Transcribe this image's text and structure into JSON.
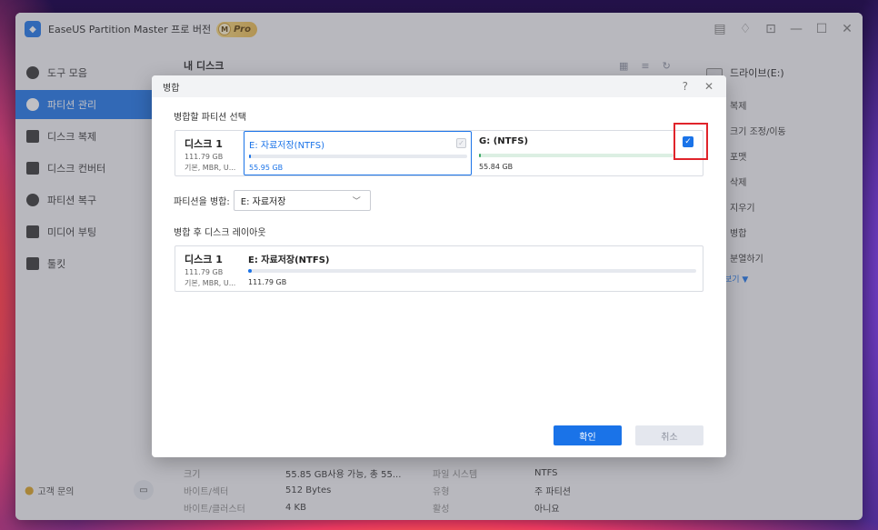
{
  "app": {
    "title": "EaseUS Partition Master 프로 버전",
    "badge": "Pro",
    "badge_letter": "M"
  },
  "sidebar": {
    "items": [
      {
        "label": "도구 모음",
        "icon": "compass-icon"
      },
      {
        "label": "파티션 관리",
        "icon": "pie-chart-icon",
        "active": true
      },
      {
        "label": "디스크 복제",
        "icon": "disk-clone-icon"
      },
      {
        "label": "디스크 컨버터",
        "icon": "disk-converter-icon"
      },
      {
        "label": "파티션 복구",
        "icon": "partition-recovery-icon"
      },
      {
        "label": "미디어 부팅",
        "icon": "media-boot-icon"
      },
      {
        "label": "툴킷",
        "icon": "toolkit-icon"
      }
    ],
    "support_label": "고객 문의"
  },
  "main": {
    "header": "내 디스크"
  },
  "right_panel": {
    "title": "드라이브(E:)",
    "ops": [
      "복제",
      "크기 조정/이동",
      "포맷",
      "삭제",
      "지우기",
      "병합",
      "분열하기"
    ],
    "more": "보기 ▼"
  },
  "properties": [
    {
      "k1": "크기",
      "v1": "55.85 GB사용 가능, 총 55...",
      "k2": "파일 시스템",
      "v2": "NTFS"
    },
    {
      "k1": "바이트/섹터",
      "v1": "512 Bytes",
      "k2": "유형",
      "v2": "주 파티션"
    },
    {
      "k1": "바이트/클러스터",
      "v1": "4 KB",
      "k2": "활성",
      "v2": "아니요"
    }
  ],
  "dialog": {
    "title": "병합",
    "select_label": "병합할 파티션 선택",
    "disk": {
      "name": "디스크 1",
      "size": "111.79 GB",
      "type": "기본, MBR, U..."
    },
    "partitions": [
      {
        "name": "E: 자료저장(NTFS)",
        "size": "55.95 GB",
        "selected": true,
        "used_fraction": 0.005,
        "color": "#1a73e8"
      },
      {
        "name": "G: (NTFS)",
        "size": "55.84 GB",
        "selected": false,
        "checked": true,
        "used_fraction": 0.005,
        "color": "#3aa765"
      }
    ],
    "merge_to_label": "파티션을 병합:",
    "merge_to_value": "E: 자료저장",
    "layout_label": "병합 후 디스크 레이아웃",
    "result": {
      "name": "E: 자료저장(NTFS)",
      "size": "111.79 GB",
      "used_fraction": 0.003
    },
    "ok_label": "확인",
    "cancel_label": "취소"
  }
}
